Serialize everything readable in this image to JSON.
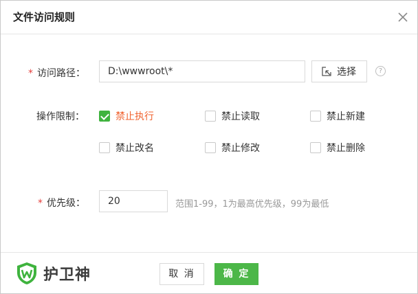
{
  "dialog": {
    "title": "文件访问规则"
  },
  "path": {
    "required_mark": "*",
    "label": "访问路径：",
    "value": "D:\\wwwroot\\*",
    "select_label": "选择",
    "help": "?"
  },
  "ops": {
    "label": "操作限制：",
    "items": [
      {
        "label": "禁止执行",
        "checked": true
      },
      {
        "label": "禁止读取",
        "checked": false
      },
      {
        "label": "禁止新建",
        "checked": false
      },
      {
        "label": "禁止改名",
        "checked": false
      },
      {
        "label": "禁止修改",
        "checked": false
      },
      {
        "label": "禁止删除",
        "checked": false
      }
    ]
  },
  "priority": {
    "required_mark": "*",
    "label": "优先级：",
    "value": "20",
    "hint": "范围1-99，1为最高优先级，99为最低"
  },
  "footer": {
    "brand": "护卫神",
    "cancel_label": "取 消",
    "ok_label": "确 定"
  },
  "colors": {
    "accent_green": "#4cb748",
    "active_orange": "#f0622e",
    "required_red": "#e5403d"
  }
}
